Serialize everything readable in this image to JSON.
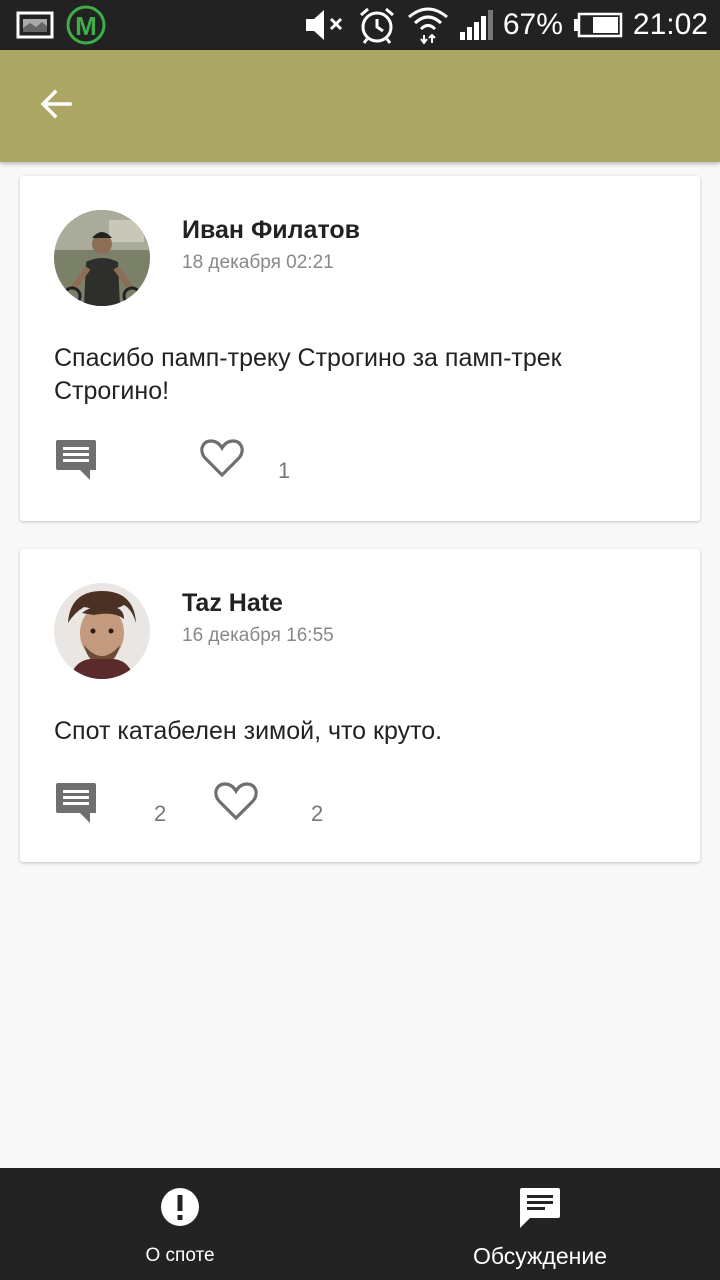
{
  "status_bar": {
    "battery": "67%",
    "time": "21:02",
    "icons": [
      "image-icon",
      "metro-icon",
      "mute-icon",
      "alarm-icon",
      "wifi-icon",
      "signal-icon",
      "battery-icon"
    ]
  },
  "toolbar": {
    "color": "#aba664",
    "back_icon": "arrow-back-icon"
  },
  "posts": [
    {
      "author": "Иван Филатов",
      "date": "18 декабря 02:21",
      "text": "Спасибо памп-треку Строгино за памп-трек Строгино!",
      "comments": "",
      "likes": "1"
    },
    {
      "author": "Taz Hate",
      "date": "16 декабря 16:55",
      "text": "Спот катабелен зимой, что круто.",
      "comments": "2",
      "likes": "2"
    }
  ],
  "bottom_nav": {
    "tabs": [
      {
        "label": "О споте",
        "icon": "info-icon"
      },
      {
        "label": "Обсуждение",
        "icon": "chat-icon",
        "active": true
      }
    ]
  }
}
